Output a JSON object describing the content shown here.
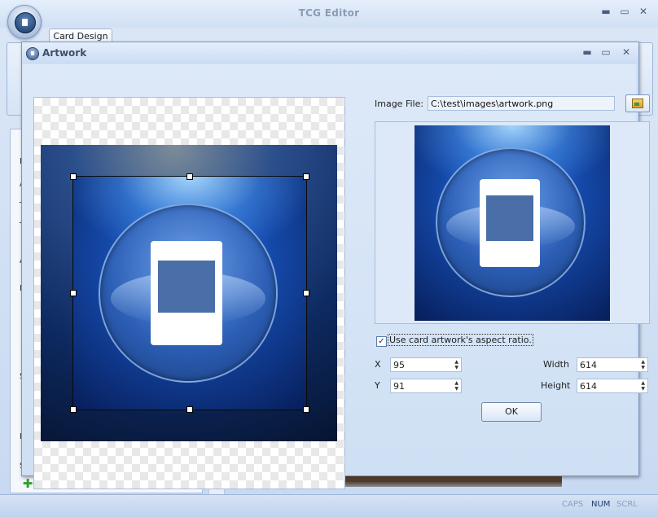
{
  "app": {
    "title": "TCG Editor",
    "ribbon_tab": "Card Design",
    "side_letters": [
      "B",
      "A",
      "T",
      "T",
      "A",
      "D",
      "S",
      "L",
      "S"
    ],
    "status": {
      "caps": "CAPS",
      "num": "NUM",
      "scrl": "SCRL"
    }
  },
  "dialog": {
    "title": "Artwork",
    "image_file_label": "Image File:",
    "image_file_value": "C:\\test\\images\\artwork.png",
    "aspect_checkbox": {
      "label": "Use card artwork's aspect ratio.",
      "checked": true
    },
    "fields": {
      "x": {
        "label": "X",
        "value": "95"
      },
      "y": {
        "label": "Y",
        "value": "91"
      },
      "width": {
        "label": "Width",
        "value": "614"
      },
      "height": {
        "label": "Height",
        "value": "614"
      }
    },
    "ok_label": "OK"
  },
  "icons": {
    "add": "plus-icon",
    "edit": "pencil-icon",
    "delete": "delete-icon",
    "move_up": "arrow-up-icon",
    "move_down": "arrow-down-icon",
    "browse": "image-icon"
  },
  "colors": {
    "accent": "#2f7ae4",
    "add": "#2ea02e",
    "delete": "#d42020"
  }
}
